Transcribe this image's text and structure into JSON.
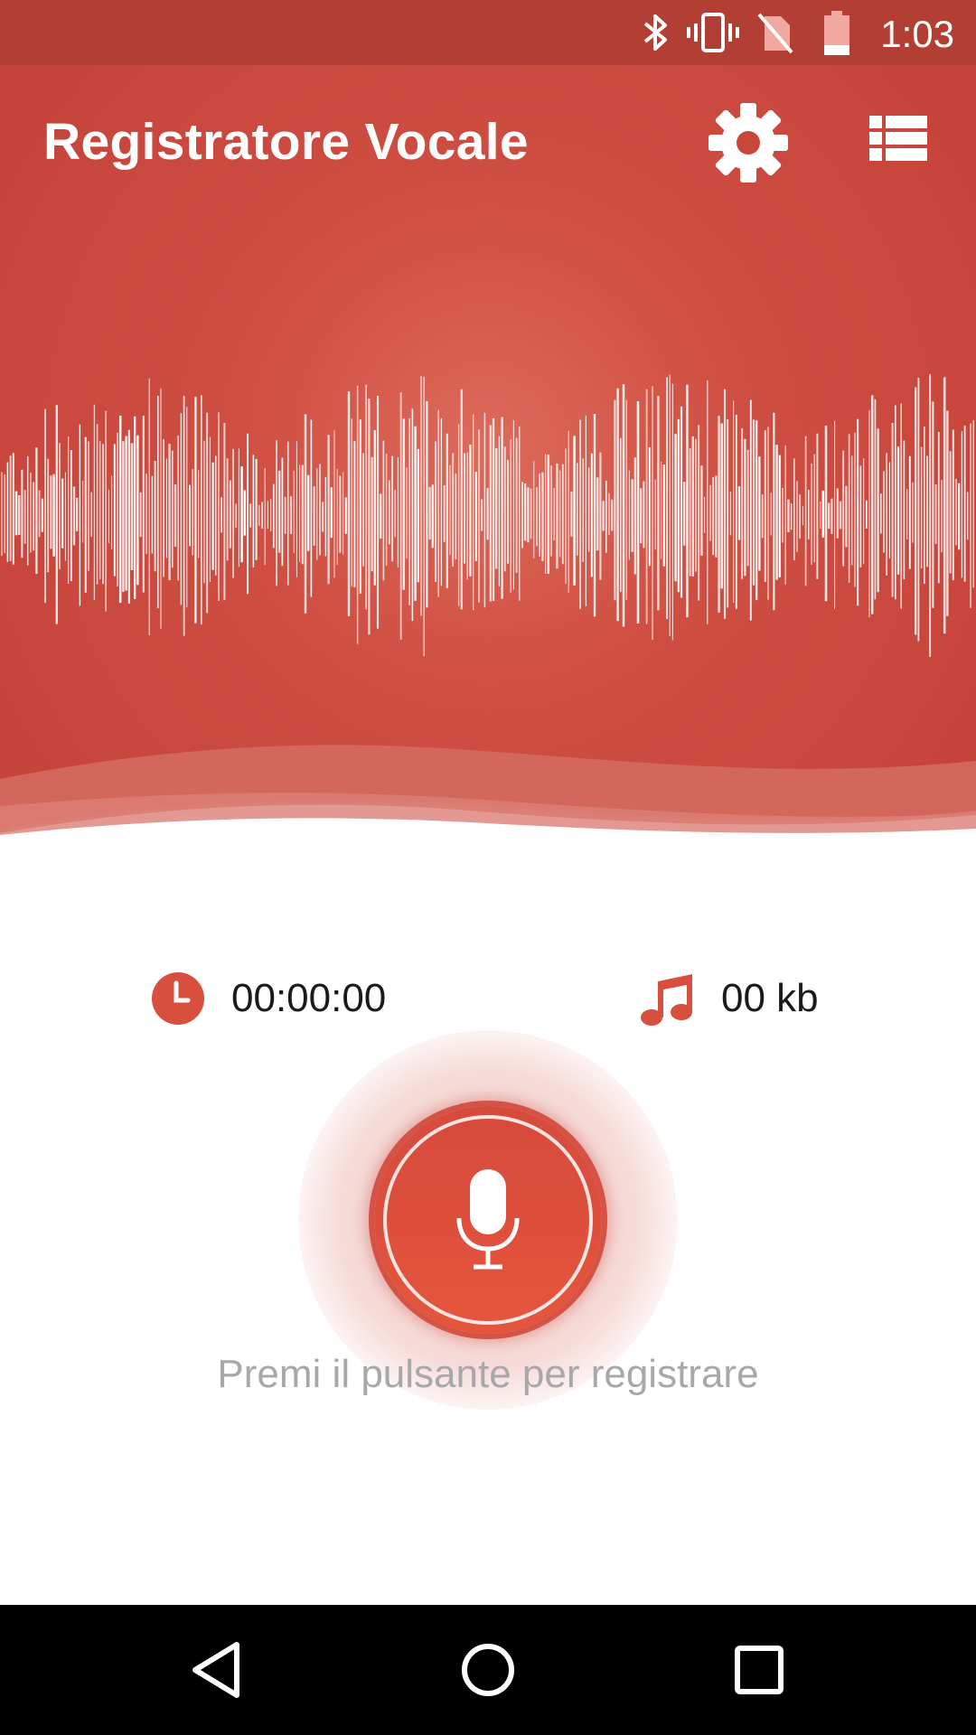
{
  "status_bar": {
    "time": "1:03",
    "icons": [
      "bluetooth-icon",
      "vibrate-icon",
      "no-sim-icon",
      "battery-icon"
    ]
  },
  "header": {
    "title": "Registratore Vocale",
    "settings_icon": "gear-icon",
    "list_icon": "list-icon"
  },
  "info": {
    "duration": "00:00:00",
    "size": "00 kb",
    "duration_icon": "clock-icon",
    "size_icon": "music-note-icon"
  },
  "record": {
    "hint": "Premi il pulsante per registrare",
    "icon": "microphone-icon"
  },
  "nav": {
    "back_icon": "back-icon",
    "home_icon": "home-icon",
    "recents_icon": "recents-icon"
  },
  "colors": {
    "primary": "#c9463b",
    "status_bar": "#b33f34",
    "accent": "#e0513f",
    "hint_text": "#a8a8a8"
  }
}
